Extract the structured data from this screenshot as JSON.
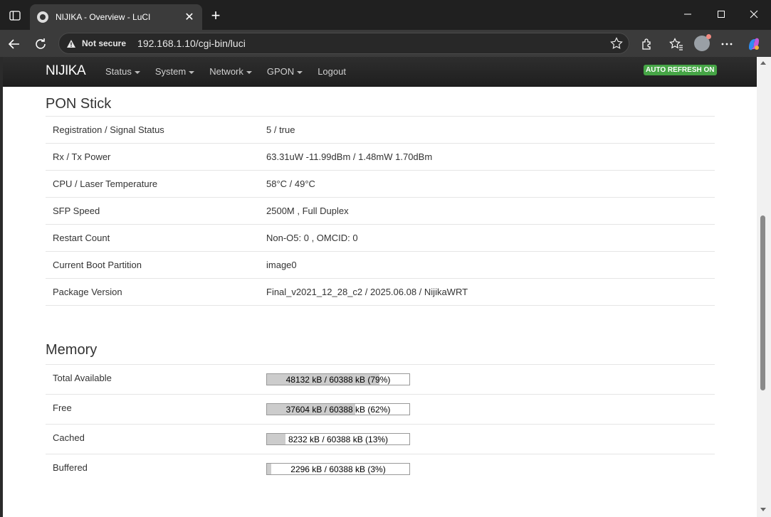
{
  "browser": {
    "tab_title": "NIJIKA - Overview - LuCI",
    "security_label": "Not secure",
    "url": "192.168.1.10/cgi-bin/luci"
  },
  "navbar": {
    "brand": "NIJIKA",
    "menu": [
      "Status",
      "System",
      "Network",
      "GPON"
    ],
    "logout": "Logout",
    "badge": "AUTO REFRESH ON",
    "badge_color": "#46a546"
  },
  "pon": {
    "title": "PON Stick",
    "rows": [
      {
        "label": "Registration / Signal Status",
        "value": "5 / true"
      },
      {
        "label": "Rx / Tx Power",
        "value": "63.31uW -11.99dBm / 1.48mW 1.70dBm"
      },
      {
        "label": "CPU / Laser Temperature",
        "value": "58°C / 49°C"
      },
      {
        "label": "SFP Speed",
        "value": "2500M , Full Duplex"
      },
      {
        "label": "Restart Count",
        "value": "Non-O5: 0 , OMCID: 0"
      },
      {
        "label": "Current Boot Partition",
        "value": "image0"
      },
      {
        "label": "Package Version",
        "value": "Final_v2021_12_28_c2 / 2025.06.08 / NijikaWRT"
      }
    ]
  },
  "memory": {
    "title": "Memory",
    "rows": [
      {
        "label": "Total Available",
        "text": "48132 kB / 60388 kB (79%)",
        "percent": 79
      },
      {
        "label": "Free",
        "text": "37604 kB / 60388 kB (62%)",
        "percent": 62
      },
      {
        "label": "Cached",
        "text": "8232 kB / 60388 kB (13%)",
        "percent": 13
      },
      {
        "label": "Buffered",
        "text": "2296 kB / 60388 kB (3%)",
        "percent": 3
      }
    ]
  }
}
